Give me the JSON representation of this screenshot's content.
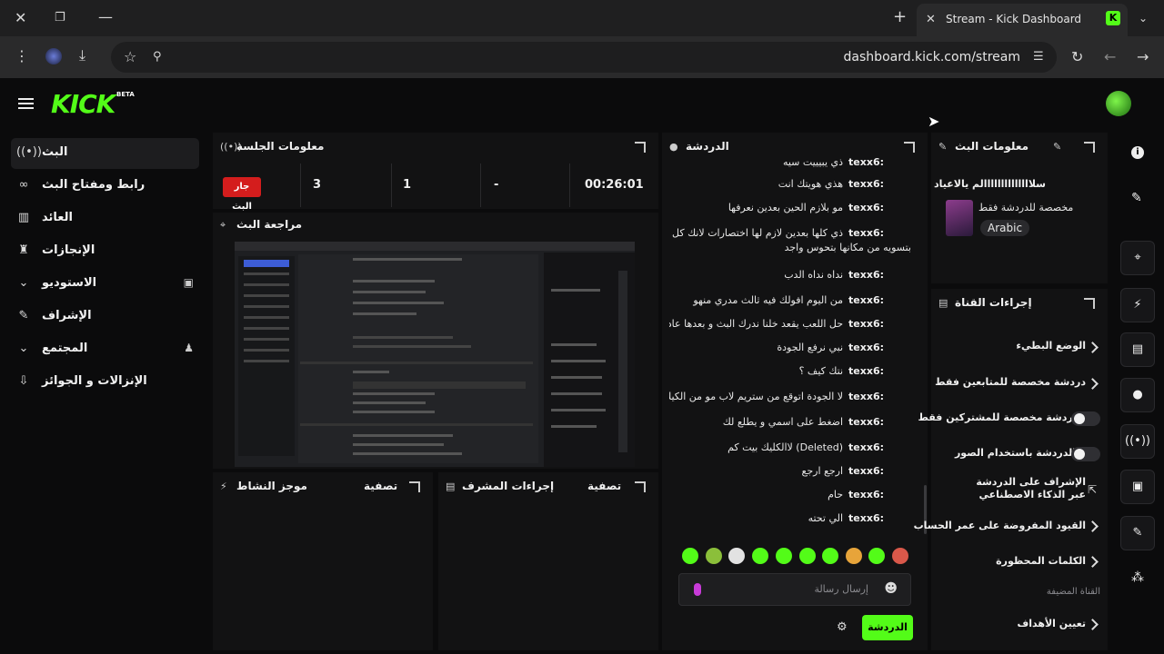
{
  "browser": {
    "tab_title": "Stream - Kick Dashboard",
    "url": "dashboard.kick.com/stream"
  },
  "header": {
    "logo": "KICK",
    "beta": "BETA"
  },
  "sidebar": {
    "items": [
      {
        "label": "البث",
        "icon": "broadcast-icon",
        "active": true
      },
      {
        "label": "رابط ومفتاح البث",
        "icon": "link-icon"
      },
      {
        "label": "العائد",
        "icon": "revenue-icon"
      },
      {
        "label": "الإنجازات",
        "icon": "trophy-icon"
      },
      {
        "label": "الاستوديو",
        "icon": "studio-icon",
        "expandable": true
      },
      {
        "label": "الإشراف",
        "icon": "wrench-icon"
      },
      {
        "label": "المجتمع",
        "icon": "community-icon",
        "expandable": true
      },
      {
        "label": "الإنزالات و الجوائز",
        "icon": "drops-icon"
      }
    ]
  },
  "session": {
    "title": "معلومات الجلسة",
    "live_badge": "جار البث",
    "stats": [
      "3",
      "1",
      "-",
      "00:26:01"
    ]
  },
  "preview": {
    "title": "مراجعة البث"
  },
  "activity": {
    "title": "موجز النشاط",
    "filter": "تصفية"
  },
  "modactions": {
    "title": "إجراءات المشرف",
    "filter": "تصفية"
  },
  "chat": {
    "title": "الدردشة",
    "messages": [
      {
        "user": "texx6:",
        "text": "ذي يبيييت سيه"
      },
      {
        "user": "texx6:",
        "text": "هذي هويتك انت"
      },
      {
        "user": "texx6:",
        "text": "مو بلازم الحين بعدين نعرفها"
      },
      {
        "user": "texx6:",
        "text": "ذي كلها بعدين لازم لها اختصارات لانك كل شيء"
      },
      {
        "user": "",
        "text": "بتسويه من مكانها بتحوس واجد"
      },
      {
        "user": "texx6:",
        "text": "نداه نداه الدب"
      },
      {
        "user": "texx6:",
        "text": "من اليوم افولك فيه ثالث مدري منهو"
      },
      {
        "user": "texx6:",
        "text": "حل اللعب يقعد خلنا ندرك البث و بعدها عادي"
      },
      {
        "user": "texx6:",
        "text": "نبي نرفع الجودة"
      },
      {
        "user": "texx6:",
        "text": "نتك كيف ؟"
      },
      {
        "user": "texx6:",
        "text": "لا الجودة اتوقع من ستريم لاب مو من الكيك"
      },
      {
        "user": "texx6:",
        "text": "اضغط على اسمي و يطلع لك"
      },
      {
        "user": "texx6:",
        "text": "لاالكليك بيت كم (Deleted)"
      },
      {
        "user": "texx6:",
        "text": "ارجع ارجع"
      },
      {
        "user": "texx6:",
        "text": "حام"
      },
      {
        "user": "texx6:",
        "text": "الي تحته"
      }
    ],
    "input_placeholder": "إرسال رسالة",
    "send_label": "الدردشة"
  },
  "stream_info": {
    "title": "معلومات البث",
    "stream_title": "سلاااااااااااااالم يالاعياد",
    "category": "مخصصة للدردشة فقط",
    "language": "Arabic"
  },
  "channel_actions": {
    "title": "إجراءات القناة",
    "rows": [
      {
        "label": "الوضع البطيء",
        "control": "chevron"
      },
      {
        "label": "دردشة مخصصة للمتابعين فقط",
        "control": "chevron"
      },
      {
        "label": "الدردشة مخصصة للمشتركين فقط",
        "control": "toggle"
      },
      {
        "label": "الدردشة باستخدام الصور…",
        "control": "toggle"
      },
      {
        "label": "الإشراف على الدردشة عبر الذكاء الاصطناعي",
        "control": "external"
      },
      {
        "label": "القيود المفروضة على عمر الحساب",
        "control": "chevron"
      },
      {
        "label": "الكلمات المحظورة",
        "control": "chevron"
      }
    ],
    "hosted_label": "القناة المضيفة",
    "goals_label": "تعيين الأهداف"
  },
  "colors": {
    "accent": "#53fc18",
    "live": "#d41d1d",
    "panel": "#121213"
  }
}
